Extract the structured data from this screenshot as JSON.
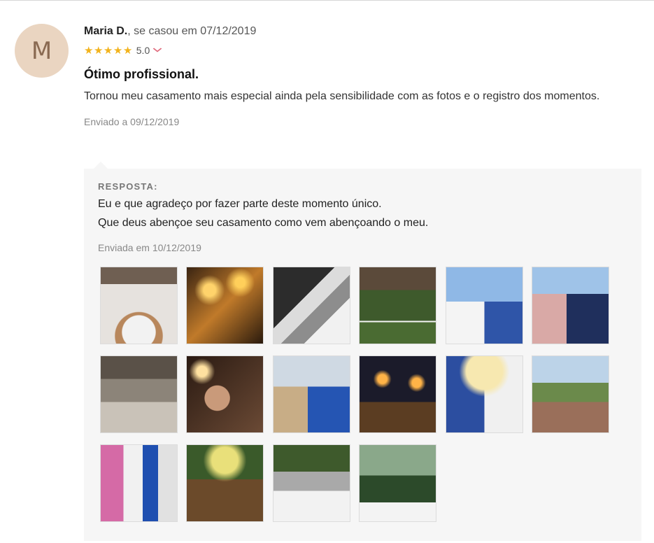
{
  "review": {
    "avatar_letter": "M",
    "author": "Maria D.",
    "married_text": ", se casou em 07/12/2019",
    "rating": "5.0",
    "stars": 5,
    "title": "Ótimo profissional.",
    "body": "Tornou meu casamento mais especial ainda pela sensibilidade com as fotos e o registro dos momentos.",
    "sent_date": "Enviado a 09/12/2019"
  },
  "reply": {
    "label": "RESPOSTA:",
    "line1": "Eu e que agradeço por fazer parte deste momento único.",
    "line2": "Que deus abençoe seu casamento como vem abençoando o meu.",
    "sent_date": "Enviada em 10/12/2019"
  },
  "colors": {
    "star": "#f2b31c",
    "accent_chevron": "#e0697b",
    "avatar_bg": "#ead5c1",
    "reply_bg": "#f6f6f6"
  },
  "gallery": {
    "photo_count": 16,
    "photos": [
      {
        "name": "photo-bride-reception-hall"
      },
      {
        "name": "photo-ring-exchange-bokeh"
      },
      {
        "name": "photo-ring-box"
      },
      {
        "name": "photo-bride-garden-arch"
      },
      {
        "name": "photo-couple-blue-sky"
      },
      {
        "name": "photo-couple-pink-dress"
      },
      {
        "name": "photo-dining-room"
      },
      {
        "name": "photo-bride-portrait-lights"
      },
      {
        "name": "photo-couple-with-mother"
      },
      {
        "name": "photo-couple-dance-hearts"
      },
      {
        "name": "photo-couple-heart-hands"
      },
      {
        "name": "photo-outdoor-ceremony-palms"
      },
      {
        "name": "photo-bride-entrance-guests"
      },
      {
        "name": "photo-decorated-table-candles"
      },
      {
        "name": "photo-ceremony-altar"
      },
      {
        "name": "photo-bride-veil-garden"
      }
    ]
  }
}
